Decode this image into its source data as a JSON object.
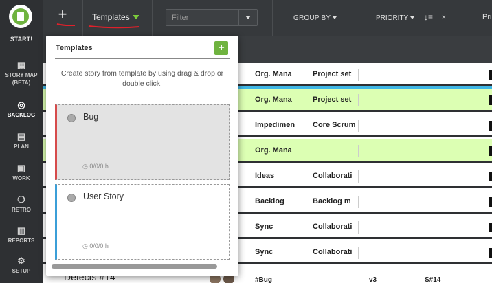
{
  "nav": {
    "logo_label": "START!",
    "items": [
      {
        "label_line1": "STORY MAP",
        "label_line2": "(BETA)",
        "icon": "map-icon",
        "glyph": "▦"
      },
      {
        "label_line1": "BACKLOG",
        "label_line2": "",
        "icon": "lightbulb-icon",
        "glyph": "💡"
      },
      {
        "label_line1": "PLAN",
        "label_line2": "",
        "icon": "plan-icon",
        "glyph": "▤"
      },
      {
        "label_line1": "WORK",
        "label_line2": "",
        "icon": "briefcase-icon",
        "glyph": "▣"
      },
      {
        "label_line1": "RETRO",
        "label_line2": "",
        "icon": "chat-icon",
        "glyph": "❍"
      },
      {
        "label_line1": "REPORTS",
        "label_line2": "",
        "icon": "bar-chart-icon",
        "glyph": "▥"
      },
      {
        "label_line1": "SETUP",
        "label_line2": "",
        "icon": "gear-icon",
        "glyph": "⚙"
      }
    ]
  },
  "toolbar": {
    "add_glyph": "+",
    "templates_label": "Templates",
    "filter_placeholder": "Filter",
    "group_by_label": "GROUP BY",
    "priority_label": "PRIORITY",
    "sort_glyph": "↓≡",
    "clear_glyph": "×",
    "cut_label": "Pri"
  },
  "popup": {
    "title": "Templates",
    "add_glyph": "+",
    "description": "Create story from template by using drag & drop or double click.",
    "templates": [
      {
        "name": "Bug",
        "meta": "◷ 0/0/0 h",
        "color": "#d64b4b"
      },
      {
        "name": "User Story",
        "meta": "◷ 0/0/0 h",
        "color": "#3b9fd8"
      }
    ]
  },
  "rows": [
    {
      "col1": "Org. Mana",
      "col2": "Project set",
      "green": false
    },
    {
      "col1": "Org. Mana",
      "col2": "Project set",
      "green": true
    },
    {
      "col1": "Impedimen",
      "col2": "Core Scrum",
      "green": false
    },
    {
      "col1": "Org. Mana",
      "col2": "",
      "green": true
    },
    {
      "col1": "Ideas",
      "col2": "Collaborati",
      "green": false
    },
    {
      "col1": "Backlog",
      "col2": "Backlog m",
      "green": false
    },
    {
      "col1": "Sync",
      "col2": "Collaborati",
      "green": false
    },
    {
      "col1": "Sync",
      "col2": "Collaborati",
      "green": false
    }
  ],
  "bottom_row": {
    "title": "Defects #14",
    "tag": "#Bug",
    "version": "v3",
    "story_id": "S#14"
  },
  "colors": {
    "accent_green": "#6fb33f",
    "row_highlight": "#dcffb3",
    "selection_blue": "#3fb7e6",
    "annotation_red": "#e0202a"
  }
}
